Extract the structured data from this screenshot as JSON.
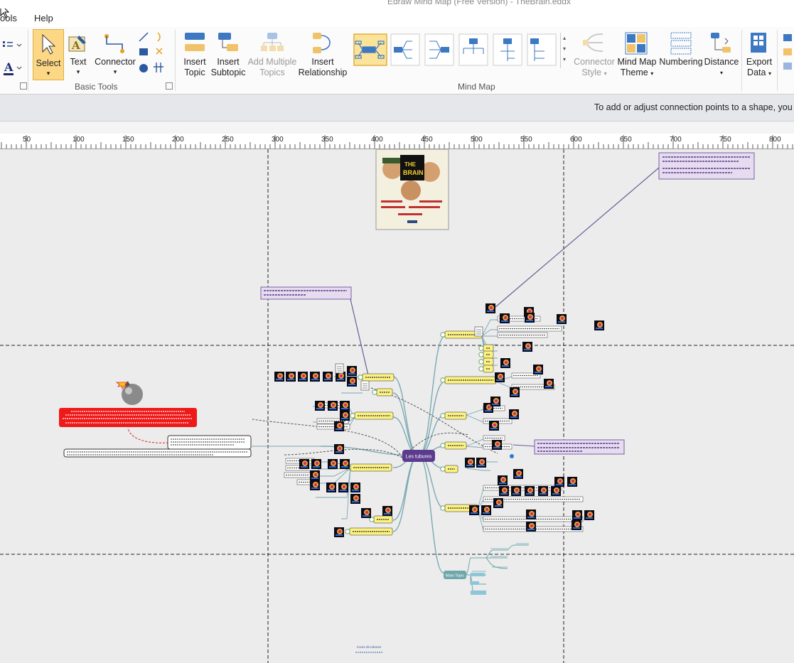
{
  "window": {
    "title": "Edraw Mind Map (Free Version) - TheBrain.eddx"
  },
  "menu": {
    "items": [
      "ools",
      "Help"
    ]
  },
  "ribbon": {
    "select_label": "Select",
    "text_label": "Text",
    "connector_label": "Connector",
    "basic_tools_label": "Basic Tools",
    "insert_topic": [
      "Insert",
      "Topic"
    ],
    "insert_subtopic": [
      "Insert",
      "Subtopic"
    ],
    "add_multiple": [
      "Add Multiple",
      "Topics"
    ],
    "insert_relationship": [
      "Insert",
      "Relationship"
    ],
    "mind_map_label": "Mind Map",
    "connector_style": [
      "Connector",
      "Style"
    ],
    "mind_map_theme": [
      "Mind Map",
      "Theme"
    ],
    "numbering": "Numbering",
    "distance": "Distance",
    "export_data": [
      "Export",
      "Data"
    ]
  },
  "infobar": {
    "message": "To add or adjust connection points to a shape, you ne"
  },
  "ruler": {
    "ticks": [
      "50",
      "100",
      "150",
      "200",
      "250",
      "300",
      "350",
      "400",
      "450",
      "500",
      "550",
      "600",
      "650",
      "700",
      "750",
      "800"
    ]
  },
  "mindmap": {
    "central_topic": "Les tubures",
    "main_topic": "Main Topic",
    "bottom_label": "Cours de tubures"
  },
  "colors": {
    "central": "#5b3b8e",
    "yellow": "#fdf27d",
    "red_note": "#ee1a1a",
    "note_bg": "#e6dcf0",
    "teal": "#6fa7aa",
    "branch": "#7ca9b4"
  },
  "icons": [
    "cursor-icon",
    "select-arrow-icon",
    "text-tool-icon",
    "connector-tool-icon",
    "shape-tools-icon",
    "insert-topic-icon",
    "insert-subtopic-icon",
    "add-multiple-icon",
    "insert-relationship-icon",
    "layout-icon",
    "connector-style-icon",
    "theme-icon",
    "numbering-icon",
    "distance-icon",
    "export-icon",
    "bomb-icon",
    "movie-poster-image"
  ]
}
